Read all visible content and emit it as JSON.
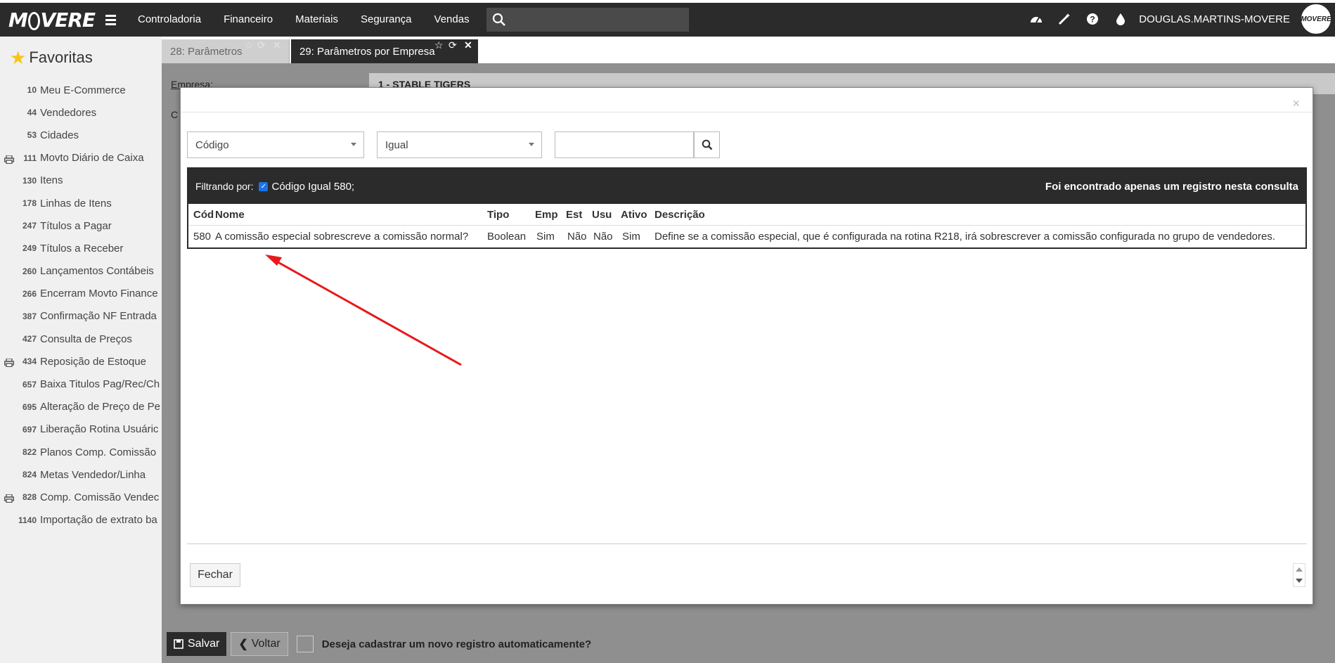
{
  "topbar": {
    "brand": "MOVERE",
    "menu": [
      "Controladoria",
      "Financeiro",
      "Materiais",
      "Segurança",
      "Vendas"
    ],
    "search_placeholder": "",
    "user": "DOUGLAS.MARTINS-MOVERE",
    "icons": [
      "dashboard-icon",
      "magic-wand-icon",
      "help-icon",
      "drop-icon"
    ]
  },
  "sidebar": {
    "title": "Favoritas",
    "items": [
      {
        "code": "10",
        "label": "Meu E-Commerce",
        "print": false
      },
      {
        "code": "44",
        "label": "Vendedores",
        "print": false
      },
      {
        "code": "53",
        "label": "Cidades",
        "print": false
      },
      {
        "code": "111",
        "label": "Movto Diário de Caixa",
        "print": true
      },
      {
        "code": "130",
        "label": "Itens",
        "print": false
      },
      {
        "code": "178",
        "label": "Linhas de Itens",
        "print": false
      },
      {
        "code": "247",
        "label": "Títulos a Pagar",
        "print": false
      },
      {
        "code": "249",
        "label": "Títulos a Receber",
        "print": false
      },
      {
        "code": "260",
        "label": "Lançamentos Contábeis",
        "print": false
      },
      {
        "code": "266",
        "label": "Encerram Movto Finance",
        "print": false
      },
      {
        "code": "387",
        "label": "Confirmação NF Entrada",
        "print": false
      },
      {
        "code": "427",
        "label": "Consulta de Preços",
        "print": false
      },
      {
        "code": "434",
        "label": "Reposição de Estoque",
        "print": true
      },
      {
        "code": "657",
        "label": "Baixa Titulos Pag/Rec/Ch",
        "print": false
      },
      {
        "code": "695",
        "label": "Alteração de Preço de Pe",
        "print": false
      },
      {
        "code": "697",
        "label": "Liberação Rotina Usuáric",
        "print": false
      },
      {
        "code": "822",
        "label": "Planos Comp. Comissão",
        "print": false
      },
      {
        "code": "824",
        "label": "Metas Vendedor/Linha",
        "print": false
      },
      {
        "code": "828",
        "label": "Comp. Comissão Vendec",
        "print": true
      },
      {
        "code": "1140",
        "label": "Importação de extrato ba",
        "print": false
      }
    ]
  },
  "tabs": [
    {
      "label": "28: Parâmetros",
      "active": false
    },
    {
      "label": "29: Parâmetros por Empresa",
      "active": true
    }
  ],
  "form": {
    "empresa_label": "Empresa:",
    "empresa_value": "1 - STABLE TIGERS",
    "c_label": "C"
  },
  "modal": {
    "close": "×",
    "field_select": "Código",
    "operator_select": "Igual",
    "search_value": "",
    "filter_prefix": "Filtrando por:",
    "filter_chip": "Código Igual 580;",
    "result_count": "Foi encontrado apenas um registro nesta consulta",
    "columns": [
      "Cód",
      "Nome",
      "Tipo",
      "Emp",
      "Est",
      "Usu",
      "Ativo",
      "Descrição"
    ],
    "rows": [
      [
        "580",
        "A comissão especial sobrescreve a comissão normal?",
        "Boolean",
        "Sim",
        "Não",
        "Não",
        "Sim",
        "Define se a comissão especial, que é configurada na rotina R218, irá sobrescrever a comissão configurada no grupo de vendedores."
      ]
    ],
    "close_button": "Fechar"
  },
  "bottom": {
    "save": "Salvar",
    "back": "Voltar",
    "auto_register": "Deseja cadastrar um novo registro automaticamente?"
  },
  "colors": {
    "topbar": "#2b2b2b",
    "annotation_arrow": "#e8191b",
    "checkbox": "#1a73e8"
  }
}
